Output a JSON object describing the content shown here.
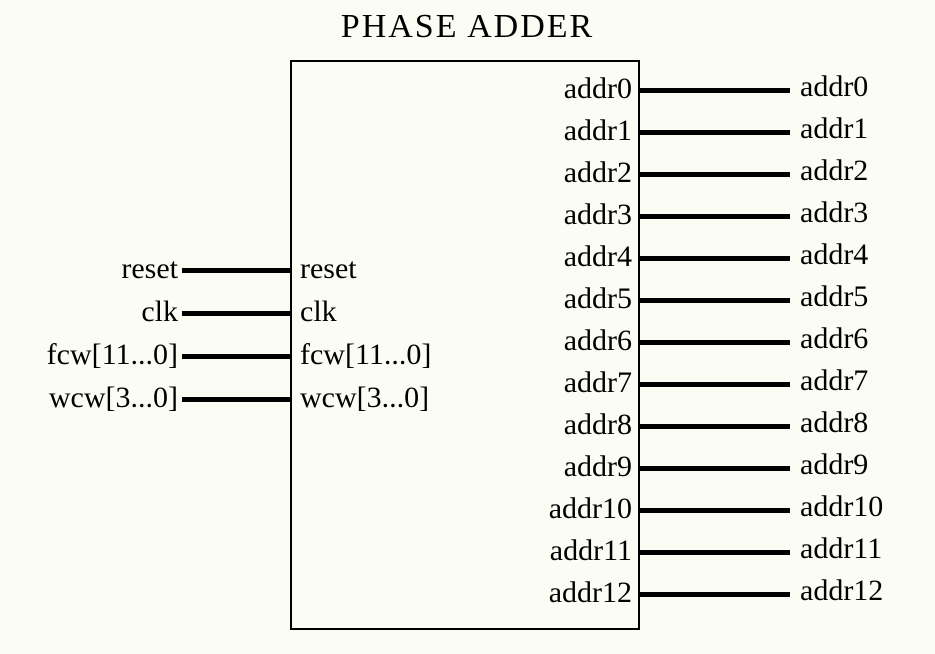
{
  "title": "PHASE  ADDER",
  "inputs": [
    {
      "ext": "reset",
      "int": "reset"
    },
    {
      "ext": "clk",
      "int": "clk"
    },
    {
      "ext": "fcw[11...0]",
      "int": "fcw[11...0]"
    },
    {
      "ext": "wcw[3...0]",
      "int": "wcw[3...0]"
    }
  ],
  "outputs": [
    {
      "int": "addr0",
      "ext": "addr0"
    },
    {
      "int": "addr1",
      "ext": "addr1"
    },
    {
      "int": "addr2",
      "ext": "addr2"
    },
    {
      "int": "addr3",
      "ext": "addr3"
    },
    {
      "int": "addr4",
      "ext": "addr4"
    },
    {
      "int": "addr5",
      "ext": "addr5"
    },
    {
      "int": "addr6",
      "ext": "addr6"
    },
    {
      "int": "addr7",
      "ext": "addr7"
    },
    {
      "int": "addr8",
      "ext": "addr8"
    },
    {
      "int": "addr9",
      "ext": "addr9"
    },
    {
      "int": "addr10",
      "ext": "addr10"
    },
    {
      "int": "addr11",
      "ext": "addr11"
    },
    {
      "int": "addr12",
      "ext": "addr12"
    }
  ]
}
